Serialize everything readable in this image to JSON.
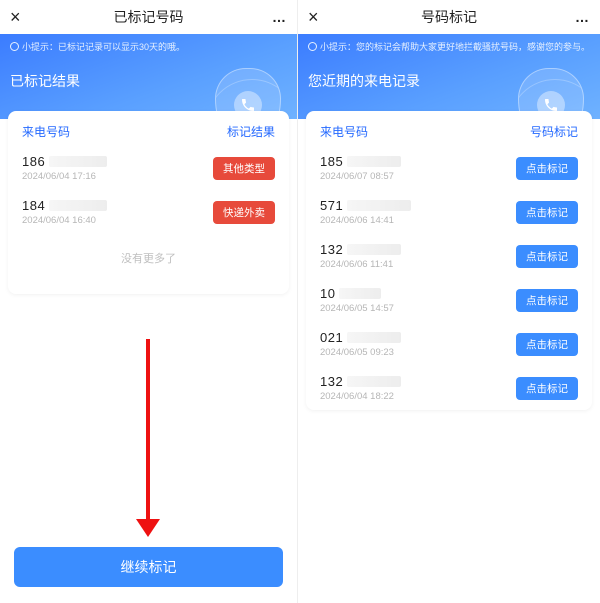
{
  "left": {
    "titlebar": {
      "title": "已标记号码",
      "close": "×",
      "more": "…"
    },
    "tip": "小提示：已标记记录可以显示30天的哦。",
    "hero_title": "已标记结果",
    "card_head": {
      "col1": "来电号码",
      "col2": "标记结果"
    },
    "rows": [
      {
        "prefix": "186",
        "mask_w": 58,
        "ts": "2024/06/04 17:16",
        "tag": "其他类型",
        "tag_style": "red"
      },
      {
        "prefix": "184",
        "mask_w": 58,
        "ts": "2024/06/04 16:40",
        "tag": "快递外卖",
        "tag_style": "red"
      }
    ],
    "nomore": "没有更多了",
    "cta": "继续标记"
  },
  "right": {
    "titlebar": {
      "title": "号码标记",
      "close": "×",
      "more": "…"
    },
    "tip": "小提示：您的标记会帮助大家更好地拦截骚扰号码，感谢您的参与。",
    "hero_title": "您近期的来电记录",
    "card_head": {
      "col1": "来电号码",
      "col2": "号码标记"
    },
    "rows": [
      {
        "prefix": "185",
        "mask_w": 54,
        "ts": "2024/06/07 08:57",
        "tag": "点击标记",
        "tag_style": "blue"
      },
      {
        "prefix": "571",
        "mask_w": 64,
        "ts": "2024/06/06 14:41",
        "tag": "点击标记",
        "tag_style": "blue"
      },
      {
        "prefix": "132",
        "mask_w": 54,
        "ts": "2024/06/06 11:41",
        "tag": "点击标记",
        "tag_style": "blue"
      },
      {
        "prefix": "10",
        "mask_w": 42,
        "ts": "2024/06/05 14:57",
        "tag": "点击标记",
        "tag_style": "blue"
      },
      {
        "prefix": "021",
        "mask_w": 54,
        "ts": "2024/06/05 09:23",
        "tag": "点击标记",
        "tag_style": "blue"
      },
      {
        "prefix": "132",
        "mask_w": 54,
        "ts": "2024/06/04 18:22",
        "tag": "点击标记",
        "tag_style": "blue"
      }
    ]
  }
}
